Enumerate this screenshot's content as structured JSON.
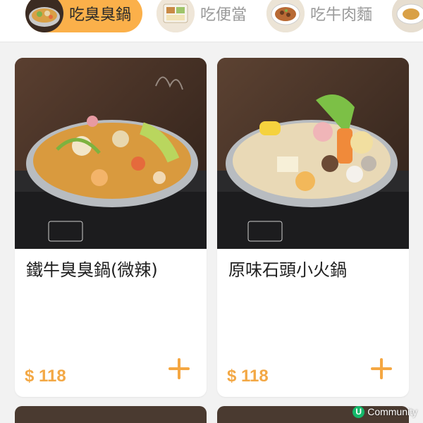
{
  "categories": [
    {
      "label": "吃臭臭鍋",
      "active": true,
      "thumb_icon": "stinky-hotpot-thumbnail"
    },
    {
      "label": "吃便當",
      "active": false,
      "thumb_icon": "bento-thumbnail"
    },
    {
      "label": "吃牛肉麵",
      "active": false,
      "thumb_icon": "beef-noodle-thumbnail"
    },
    {
      "label": "",
      "active": false,
      "thumb_icon": "dish-thumbnail"
    }
  ],
  "products": [
    {
      "name": "鐵牛臭臭鍋(微辣)",
      "price": "$ 118",
      "image": "spicy-stinky-hotpot-photo",
      "add_icon": "plus-icon"
    },
    {
      "name": "原味石頭小火鍋",
      "price": "$ 118",
      "image": "original-stone-hotpot-photo",
      "add_icon": "plus-icon"
    }
  ],
  "watermark": {
    "badge": "U",
    "text": "Community"
  },
  "colors": {
    "accent": "#fbb04a",
    "price": "#f3a845",
    "plus": "#f5a742",
    "background": "#f2f2f2"
  }
}
